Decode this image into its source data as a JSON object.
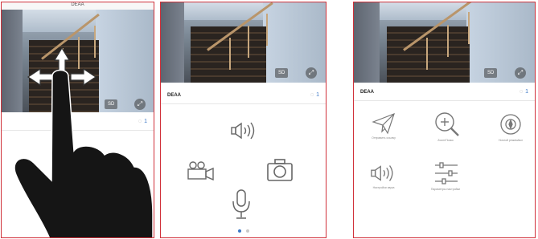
{
  "panel1": {
    "header_title": "DEAA",
    "sd_label": "SD",
    "fullscreen_glyph": "⤢",
    "user_count": "1"
  },
  "panel2": {
    "sd_label": "SD",
    "fullscreen_glyph": "⤢",
    "device_name": "DEAA",
    "user_count": "1",
    "controls": [
      "speaker-icon",
      "video-record-icon",
      "camera-icon",
      "microphone-icon"
    ],
    "page_dots": {
      "count": 2,
      "active": 1
    }
  },
  "panel3": {
    "sd_label": "SD",
    "fullscreen_glyph": "⤢",
    "device_name": "DEAA",
    "user_count": "1",
    "functions": [
      {
        "icon": "send-icon",
        "label": "Отправить ссылку"
      },
      {
        "icon": "zoom-in-icon",
        "label": "Zoom/Поиск"
      },
      {
        "icon": "pan-tilt-icon",
        "label": "Ночной режим/вкл"
      },
      {
        "icon": "speaker-icon",
        "label": "Настройки звука"
      },
      {
        "icon": "sliders-icon",
        "label": "Параметры настройки"
      }
    ]
  },
  "colors": {
    "border": "#d0313a",
    "accent": "#3b78c6"
  }
}
